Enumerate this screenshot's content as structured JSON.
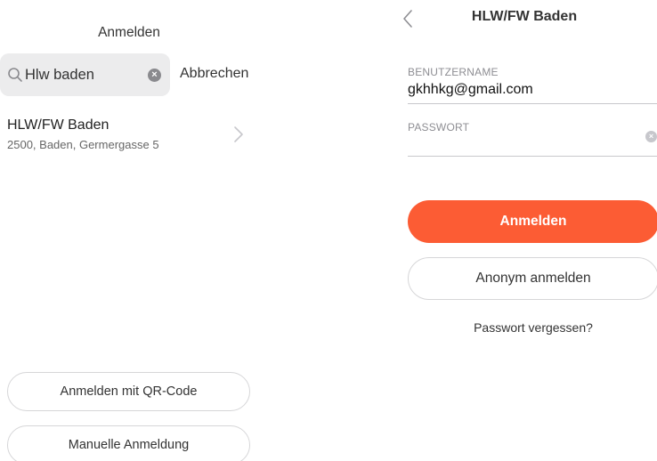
{
  "left_screen": {
    "title": "Anmelden",
    "search": {
      "value": "Hlw baden",
      "cancel_label": "Abbrechen"
    },
    "results": [
      {
        "name": "HLW/FW Baden",
        "address": "2500, Baden, Germergasse 5"
      }
    ],
    "qr_button_label": "Anmelden mit QR-Code",
    "manual_button_label": "Manuelle Anmeldung"
  },
  "right_screen": {
    "title": "HLW/FW Baden",
    "username": {
      "label": "BENUTZERNAME",
      "value": "gkhhkg@gmail.com"
    },
    "password": {
      "label": "PASSWORT",
      "value": ""
    },
    "login_button_label": "Anmelden",
    "anonymous_button_label": "Anonym anmelden",
    "forgot_password_label": "Passwort vergessen?"
  },
  "colors": {
    "accent": "#fc5c34",
    "search_bg": "#ececed"
  }
}
